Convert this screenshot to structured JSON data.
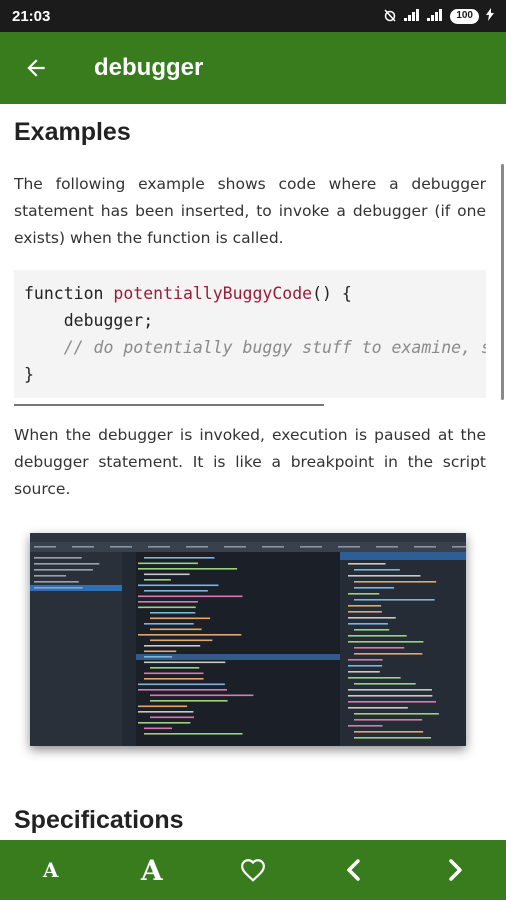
{
  "status_bar": {
    "time": "21:03",
    "battery": "100"
  },
  "app_bar": {
    "title": "debugger"
  },
  "content": {
    "examples_heading": "Examples",
    "paragraph_1": "The following example shows code where a debugger statement has been inserted, to invoke a debugger (if one exists) when the function is called.",
    "code": {
      "line1_keyword": "function ",
      "line1_name": "potentiallyBuggyCode",
      "line1_rest": "() {",
      "line2": "    debugger;",
      "line3": "    // do potentially buggy stuff to examine, step through, etc.",
      "line4": "}"
    },
    "paragraph_2": "When the debugger is invoked, execution is paused at the debugger statement. It is like a breakpoint in the script source.",
    "specifications_heading": "Specifications"
  },
  "bottom_bar": {
    "small_font_label": "A",
    "large_font_label": "A"
  },
  "colors": {
    "app_bar": "#387c1e",
    "status_bar": "#1b1b1b",
    "code_function_name": "#9b1b3a",
    "code_comment": "#8a8a8a"
  },
  "icons": [
    "back-arrow-icon",
    "favorite-heart-icon",
    "previous-chevron-icon",
    "next-chevron-icon",
    "signal-icon",
    "wifi-icon",
    "battery-icon",
    "alarm-off-icon",
    "charging-icon"
  ]
}
